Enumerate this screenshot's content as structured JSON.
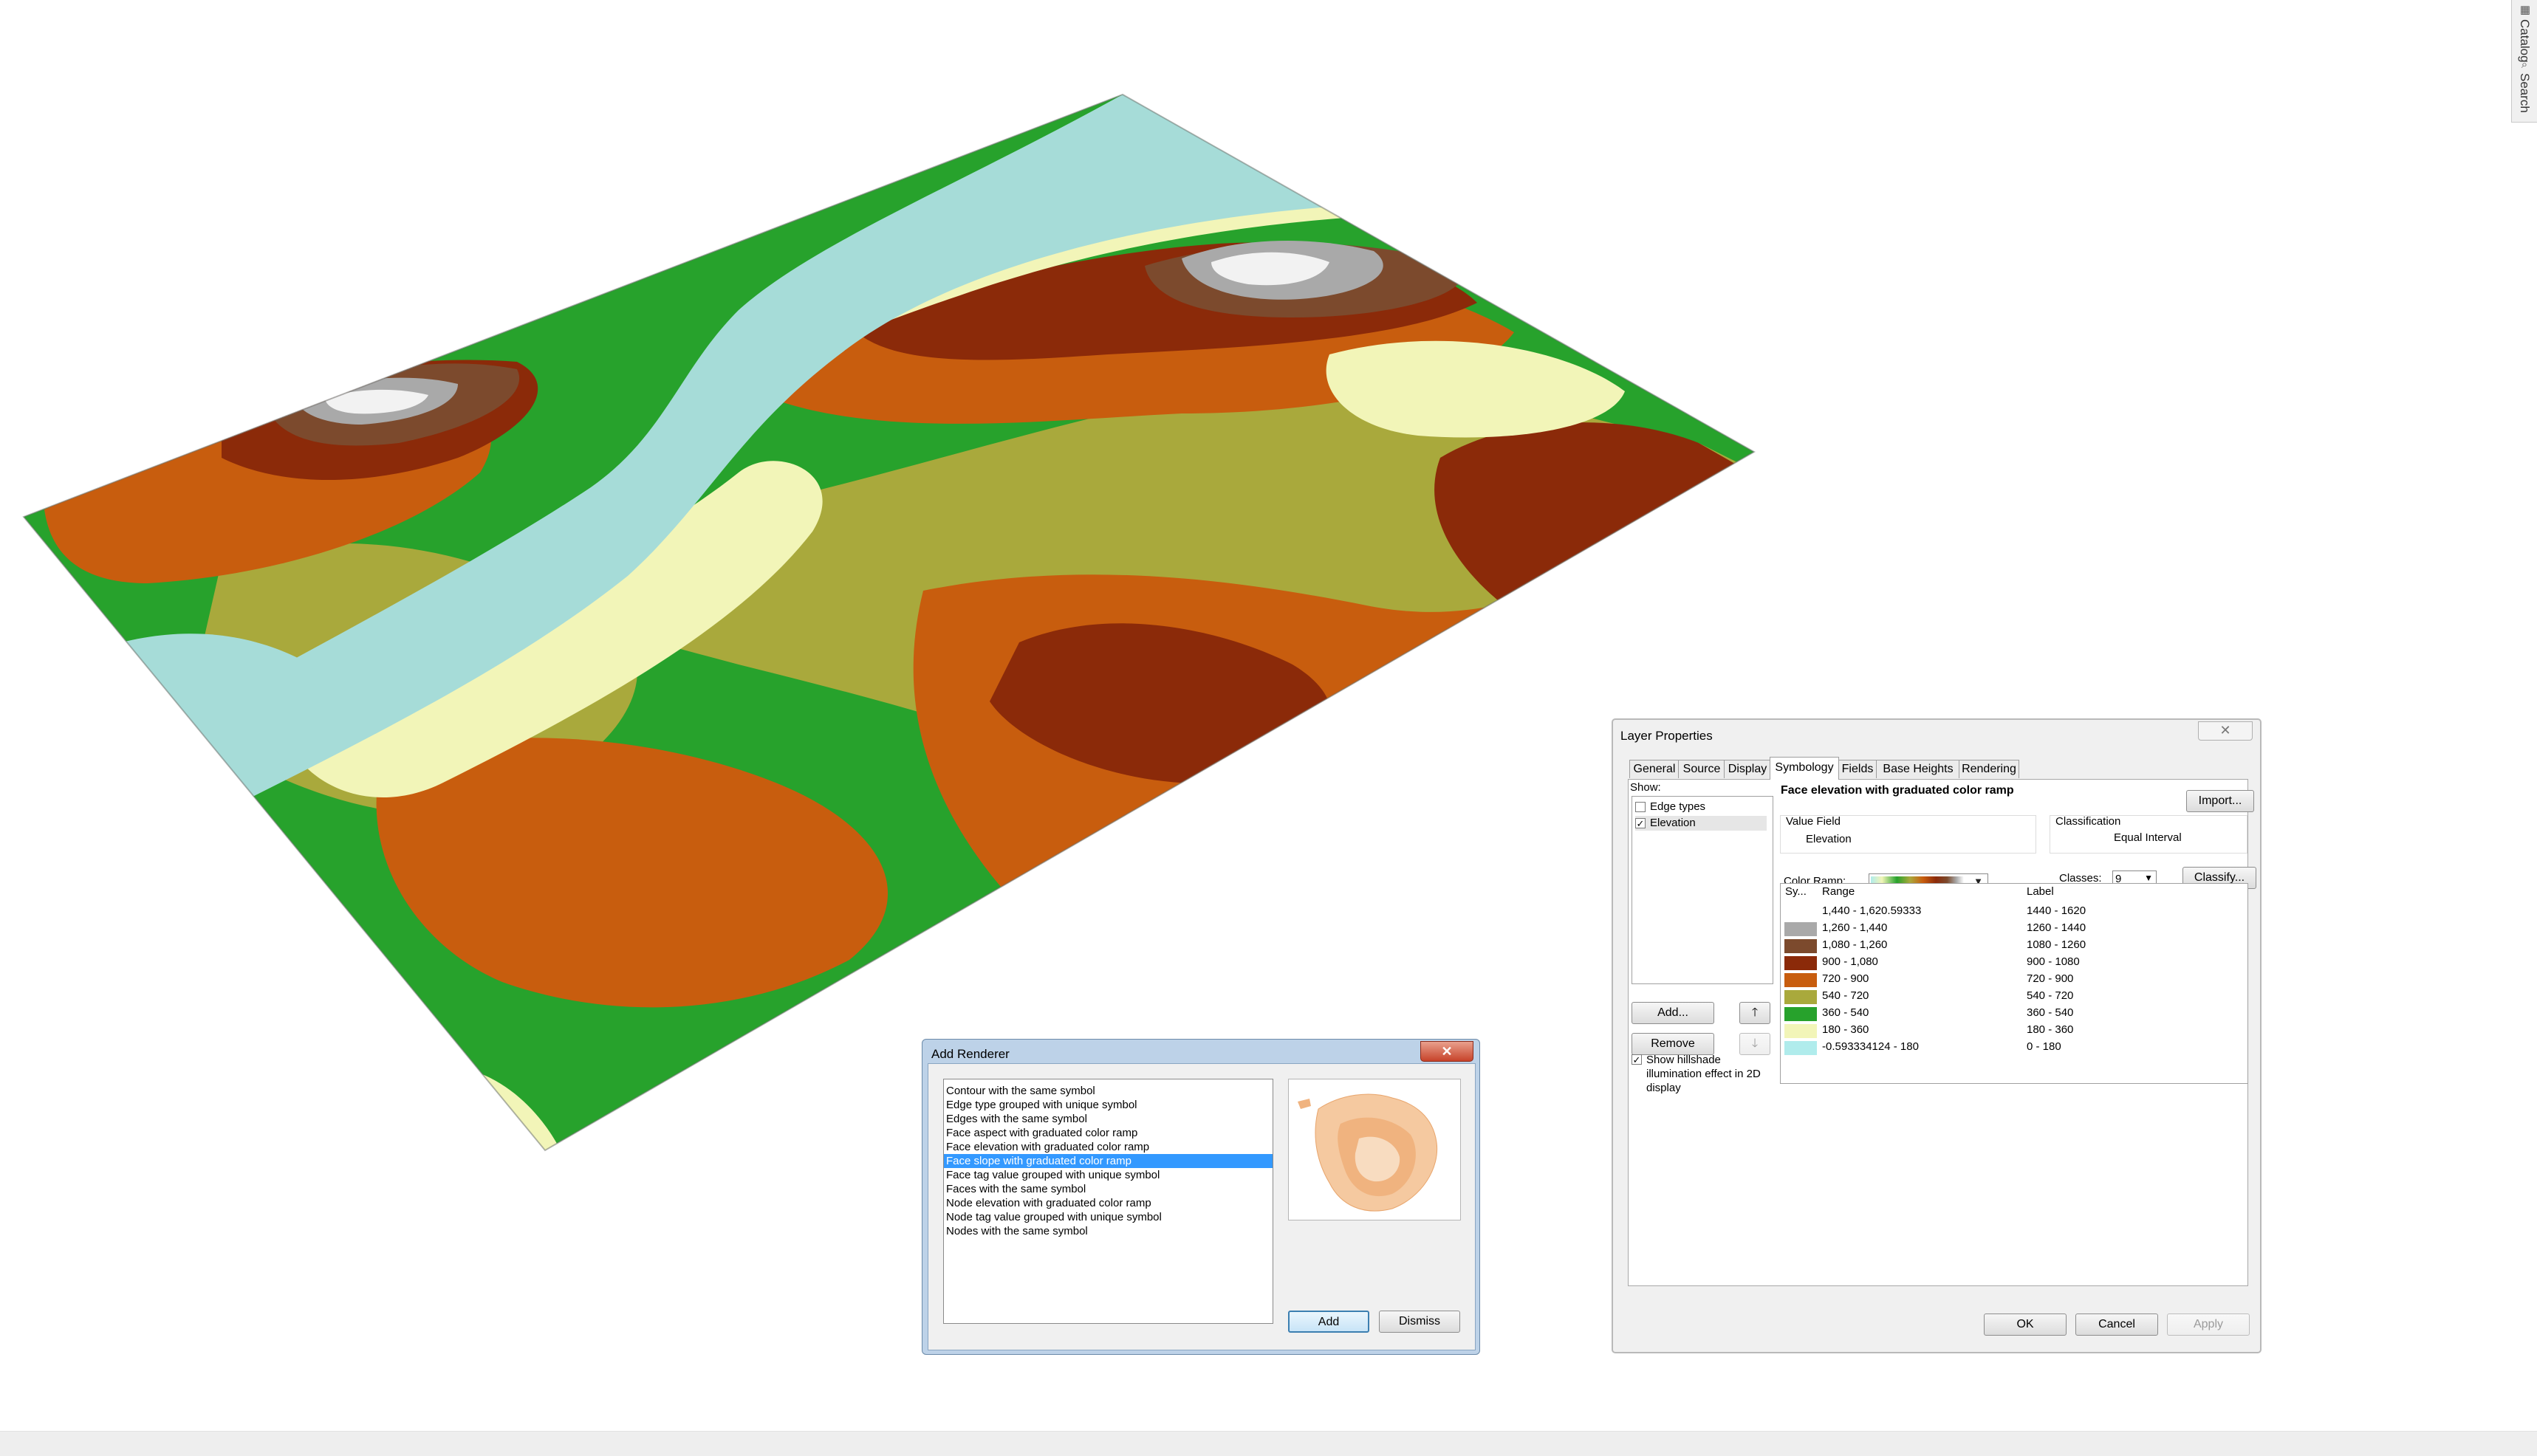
{
  "scene": {
    "colors": {
      "water": "#a6dcd8",
      "lowland": "#f2f5b8",
      "green": "#27a22c",
      "olive": "#a9a93c",
      "orange": "#c85d0e",
      "darkred": "#8b2a09",
      "brown": "#7c4a2d",
      "gray": "#a9a9a9",
      "snow": "#f2f2f2"
    }
  },
  "dock": {
    "catalog_label": "Catalog",
    "search_label": "Search"
  },
  "add_renderer": {
    "title": "Add Renderer",
    "close_symbol": "✕",
    "items": [
      "Contour with the same symbol",
      "Edge type grouped with unique symbol",
      "Edges with the same symbol",
      "Face aspect with graduated color ramp",
      "Face elevation with graduated color ramp",
      "Face slope with graduated color ramp",
      "Face tag value grouped with unique symbol",
      "Faces with the same symbol",
      "Node elevation with graduated color ramp",
      "Node tag value grouped with unique symbol",
      "Nodes with the same symbol"
    ],
    "selected_index": 5,
    "add_label": "Add",
    "dismiss_label": "Dismiss"
  },
  "layer_properties": {
    "title": "Layer Properties",
    "close_symbol": "✕",
    "tabs": [
      "General",
      "Source",
      "Display",
      "Symbology",
      "Fields",
      "Base Heights",
      "Rendering"
    ],
    "active_tab": "Symbology",
    "show_label": "Show:",
    "show_items": [
      {
        "label": "Edge types",
        "checked": false
      },
      {
        "label": "Elevation",
        "checked": true
      }
    ],
    "add_button": "Add...",
    "remove_button": "Remove",
    "up_symbol": "🡑",
    "down_symbol": "🡓",
    "hillshade_label": "Show hillshade illumination effect in 2D display",
    "renderer_title": "Face elevation with graduated color ramp",
    "import_button": "Import...",
    "value_field_label": "Value Field",
    "value_field": "Elevation",
    "classification_label": "Classification",
    "classification_method": "Equal Interval",
    "color_ramp_label": "Color Ramp:",
    "classes_label": "Classes:",
    "classes_value": "9",
    "classify_button": "Classify...",
    "columns": {
      "symbol": "Sy...",
      "range": "Range",
      "label": "Label"
    },
    "classes": [
      {
        "color": "#ffffff",
        "range": "1,440 - 1,620.59333",
        "label": "1440 - 1620"
      },
      {
        "color": "#a9a9a9",
        "range": "1,260 - 1,440",
        "label": "1260 - 1440"
      },
      {
        "color": "#7c4a2d",
        "range": "1,080 - 1,260",
        "label": "1080 - 1260"
      },
      {
        "color": "#8b2a09",
        "range": "900 - 1,080",
        "label": "900 - 1080"
      },
      {
        "color": "#c85d0e",
        "range": "720 - 900",
        "label": "720 - 900"
      },
      {
        "color": "#a9a93c",
        "range": "540 - 720",
        "label": "540 - 720"
      },
      {
        "color": "#27a22c",
        "range": "360 - 540",
        "label": "360 - 540"
      },
      {
        "color": "#f2f5b8",
        "range": "180 - 360",
        "label": "180 - 360"
      },
      {
        "color": "#b0ecec",
        "range": "-0.593334124 - 180",
        "label": "0 - 180"
      }
    ],
    "ok_button": "OK",
    "cancel_button": "Cancel",
    "apply_button": "Apply"
  }
}
